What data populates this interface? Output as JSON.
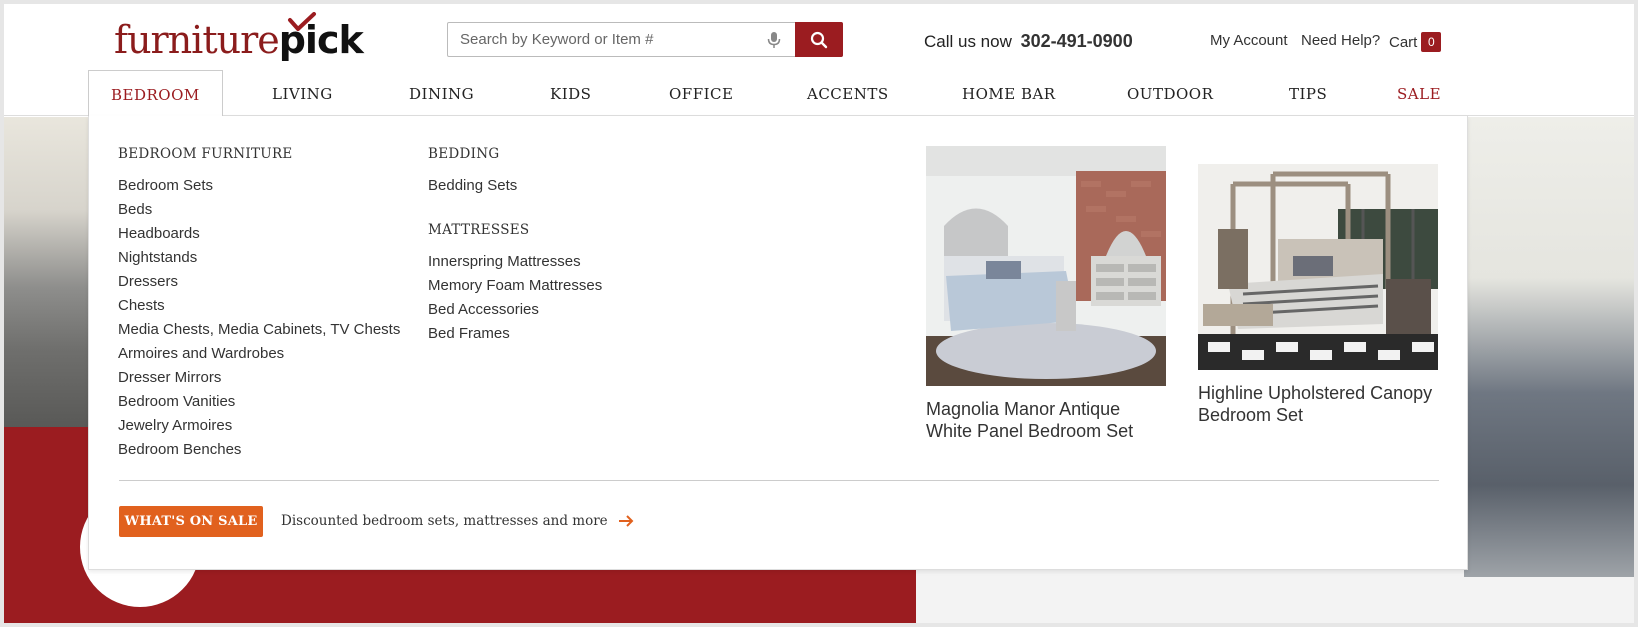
{
  "header": {
    "logo": {
      "part1": "furniture",
      "part2": "pick"
    },
    "search": {
      "placeholder": "Search by Keyword or Item #"
    },
    "call_label": "Call us now",
    "phone": "302-491-0900",
    "links": {
      "account": "My Account",
      "help": "Need Help?",
      "cart": "Cart",
      "cart_count": "0"
    }
  },
  "nav": {
    "items": [
      {
        "label": "BEDROOM",
        "active": true
      },
      {
        "label": "LIVING"
      },
      {
        "label": "DINING"
      },
      {
        "label": "KIDS"
      },
      {
        "label": "OFFICE"
      },
      {
        "label": "ACCENTS"
      },
      {
        "label": "HOME BAR"
      },
      {
        "label": "OUTDOOR"
      },
      {
        "label": "TIPS"
      },
      {
        "label": "SALE"
      }
    ]
  },
  "mega": {
    "col1": {
      "heading": "BEDROOM FURNITURE",
      "items": [
        "Bedroom Sets",
        "Beds",
        "Headboards",
        "Nightstands",
        "Dressers",
        "Chests",
        "Media Chests, Media Cabinets, TV Chests",
        "Armoires and Wardrobes",
        "Dresser Mirrors",
        "Bedroom Vanities",
        "Jewelry Armoires",
        "Bedroom Benches"
      ]
    },
    "col2": {
      "heading": "BEDDING",
      "items": [
        "Bedding Sets"
      ],
      "heading2": "MATTRESSES",
      "items2": [
        "Innerspring Mattresses",
        "Memory Foam Mattresses",
        "Bed Accessories",
        "Bed Frames"
      ]
    },
    "products": [
      {
        "title": "Magnolia Manor Antique White Panel Bedroom Set"
      },
      {
        "title": "Highline Upholstered Canopy Bedroom Set"
      }
    ],
    "sale_button": "WHAT'S ON SALE",
    "sale_text": "Discounted bedroom sets, mattresses and more"
  },
  "colors": {
    "brand_red": "#9b1c20",
    "sale_orange": "#e1611e"
  }
}
